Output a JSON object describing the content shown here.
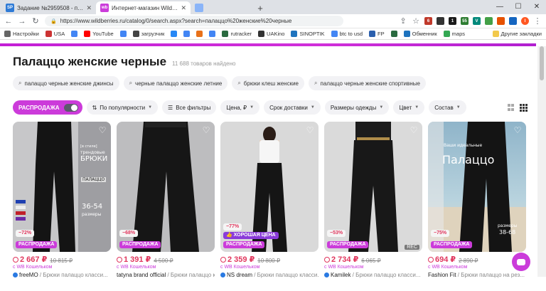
{
  "browser": {
    "tabs": [
      {
        "icon": "SP",
        "color": "#2f7bd6",
        "title": "Задание №2959508 - просмотр з...",
        "active": false
      },
      {
        "icon": "wb",
        "color": "#cb3cda",
        "title": "Интернет-магазин Wildberries: ш...",
        "active": true
      },
      {
        "icon": "",
        "color": "#8ab4f8",
        "title": "",
        "active": false
      },
      {
        "icon": "",
        "color": "#7b8794",
        "title": "",
        "active": false
      },
      {
        "icon": "",
        "color": "#4caf50",
        "title": "",
        "active": false
      }
    ],
    "url": "https://www.wildberries.ru/catalog/0/search.aspx?search=палаццо%20женские%20черные",
    "bookmarks": [
      {
        "label": "Настройки",
        "color": "#666"
      },
      {
        "label": "USA",
        "color": "#cc3333"
      },
      {
        "label": "",
        "color": "#4285f4"
      },
      {
        "label": "YouTube",
        "color": "#ff0000"
      },
      {
        "label": "",
        "color": "#4285f4"
      },
      {
        "label": "загрузчик",
        "color": "#444"
      },
      {
        "label": "",
        "color": "#2787f5"
      },
      {
        "label": "",
        "color": "#4285f4"
      },
      {
        "label": "",
        "color": "#e8711a"
      },
      {
        "label": "",
        "color": "#4285f4"
      },
      {
        "label": "rutracker",
        "color": "#2a6a3f"
      },
      {
        "label": "UAKino",
        "color": "#333"
      },
      {
        "label": "SINOPTIK",
        "color": "#1e73be"
      },
      {
        "label": "btc to usd",
        "color": "#4285f4"
      },
      {
        "label": "FP",
        "color": "#2b5fad"
      },
      {
        "label": "",
        "color": "#2a6a3f"
      },
      {
        "label": "Обменник",
        "color": "#1e73be"
      },
      {
        "label": "maps",
        "color": "#34a853"
      }
    ],
    "bookmarks_right": "Другие закладки"
  },
  "page": {
    "title": "Палаццо женские черные",
    "count": "11 688 товаров найдено",
    "suggestions": [
      "палаццо черные женские джинсы",
      "черные палаццо женские летние",
      "брюки клеш женские",
      "палаццо черные женские спортивные"
    ],
    "sale_label": "РАСПРОДАЖА",
    "filters": [
      {
        "label": "По популярности",
        "icon": "sort-icon"
      },
      {
        "label": "Все фильтры",
        "icon": "filter-icon"
      },
      {
        "label": "Цена, ₽",
        "icon": ""
      },
      {
        "label": "Срок доставки",
        "icon": ""
      },
      {
        "label": "Размеры одежды",
        "icon": ""
      },
      {
        "label": "Цвет",
        "icon": ""
      },
      {
        "label": "Состав",
        "icon": ""
      }
    ]
  },
  "products": [
    {
      "discount": "−72%",
      "good_price": "",
      "sale": "РАСПРОДАЖА",
      "price": "2 667 ₽",
      "old_price": "10 815 ₽",
      "wallet": "с WB Кошельком",
      "brand": "freeMO",
      "name": " / Брюки палаццо класси...",
      "verified": true,
      "bg": "#c9c9c9",
      "rec": false,
      "overlay": [
        "[в стиле]",
        "трендовые",
        "БРЮКИ",
        "ПАЛАЦЦО",
        "36-54",
        "размеры"
      ]
    },
    {
      "discount": "−68%",
      "good_price": "",
      "sale": "РАСПРОДАЖА",
      "price": "1 391 ₽",
      "old_price": "4 500 ₽",
      "wallet": "с WB Кошельком",
      "brand": "tatyna brand official",
      "name": " / Брюки палаццо класси...",
      "verified": false,
      "bg": "#bdbdbd",
      "rec": false,
      "overlay": []
    },
    {
      "discount": "−77%",
      "good_price": "ХОРОШАЯ ЦЕНА",
      "sale": "РАСПРОДАЖА",
      "price": "2 359 ₽",
      "old_price": "10 800 ₽",
      "wallet": "с WB Кошельком",
      "brand": "NS dream",
      "name": " / Брюки палаццо класси...",
      "verified": true,
      "bg": "#d6d6d6",
      "rec": false,
      "overlay": []
    },
    {
      "discount": "−53%",
      "good_price": "",
      "sale": "РАСПРОДАЖА",
      "price": "2 734 ₽",
      "old_price": "6 065 ₽",
      "wallet": "с WB Кошельком",
      "brand": "Kamilek",
      "name": " / Брюки палаццо класси...",
      "verified": true,
      "bg": "#d8d8d8",
      "rec": true,
      "overlay": []
    },
    {
      "discount": "−75%",
      "good_price": "",
      "sale": "РАСПРОДАЖА",
      "price": "694 ₽",
      "old_price": "2 890 ₽",
      "wallet": "с WB Кошельком",
      "brand": "Fashion Fit",
      "name": " / Брюки палаццо на рез...",
      "verified": false,
      "bg": "#7aa6bf",
      "rec": false,
      "overlay": [
        "Ваши идеальные",
        "Палаццо",
        "размеры",
        "38-68"
      ]
    }
  ],
  "colors": {
    "brand": "#cb3cda",
    "price": "#e0355c"
  }
}
